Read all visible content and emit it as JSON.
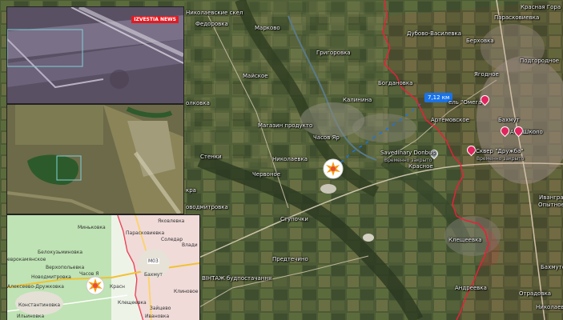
{
  "map": {
    "labels": {
      "top_partial": "Николаевские скел",
      "fedorovka": "Федоровка",
      "markovo": "Марково",
      "grigorovka": "Григоровка",
      "maiskoe": "Майское",
      "dubovo_vasilevka": "Дубово-Василевка",
      "berkhovka": "Берховка",
      "krasnaya_gora": "Красная Гора",
      "paraskoviivka": "Парасковиевка",
      "podgorodnoe": "Подгородное",
      "yagodnoe": "Ягодное",
      "bogdanovka": "Богдановка",
      "kalinina": "Калинина",
      "distance": "7,12 км",
      "omega": "ель \"Омега\"",
      "artemovskoe": "Артемовское",
      "bakhmut": "Бахмут",
      "atlantic": "Атлантик",
      "shkolo": "Школо",
      "magazin": "Магазин продукто",
      "chasov_yar": "Часов Яр",
      "stenki": "Стенки",
      "nikolaevka": "Николаевка",
      "chervonoe": "Червоное",
      "krasnoe": "Красное",
      "savedinary": "Savedinary Donbus",
      "savedinary_sub": "Временно закрыто",
      "skver": "Сквер \"Дружба\"",
      "skver_sub": "Временно закрыто",
      "ivangrad": "Иванград",
      "opytnoe": "Опытное",
      "stupochki": "Ступочки",
      "klescheevka": "Клещеевка",
      "predtechino": "Предтечино",
      "vintage": "ВІНТАЖ будпостачання",
      "andreevka": "Андреевка",
      "otradovka": "Отрадовка",
      "bakhmutsk": "Бахмутск",
      "nikolaevka2": "Николаевка",
      "olkovka": "олковка",
      "kra_left": "кра",
      "novodmitrovka": "оводмитровка"
    },
    "explosion_icon": "explosion-icon",
    "frontline_color": "#e8213a"
  },
  "insets": {
    "top": {
      "tv_logo": "IZVESTIA NEWS"
    },
    "map": {
      "labels": {
        "yakovlevka": "Яковлевка",
        "minkovka": "Миньковка",
        "paraskoviivka": "Парасковиевка",
        "soledar": "Соледар",
        "belokuzminovka": "Белокузьминовка",
        "vladim": "Влади",
        "verkhnekamyanske": "еврокамянское",
        "vertopolovka": "Верхопольевка",
        "m03": "М03",
        "bakhmut": "Бахмут",
        "novodmitrovka": "Новодмитровка",
        "kleshkovka": "Клиновое",
        "alekseevo": "Алексеево-Дружковка",
        "chasov": "Часов Я",
        "krasnoe": "Красн",
        "konstantinovka": "Константиновка",
        "kleshcheevka": "Клещеевка",
        "zaitsevo": "Зайцево",
        "ilinovka": "Ильиновка",
        "ivanovka": "Ивановка"
      }
    }
  }
}
